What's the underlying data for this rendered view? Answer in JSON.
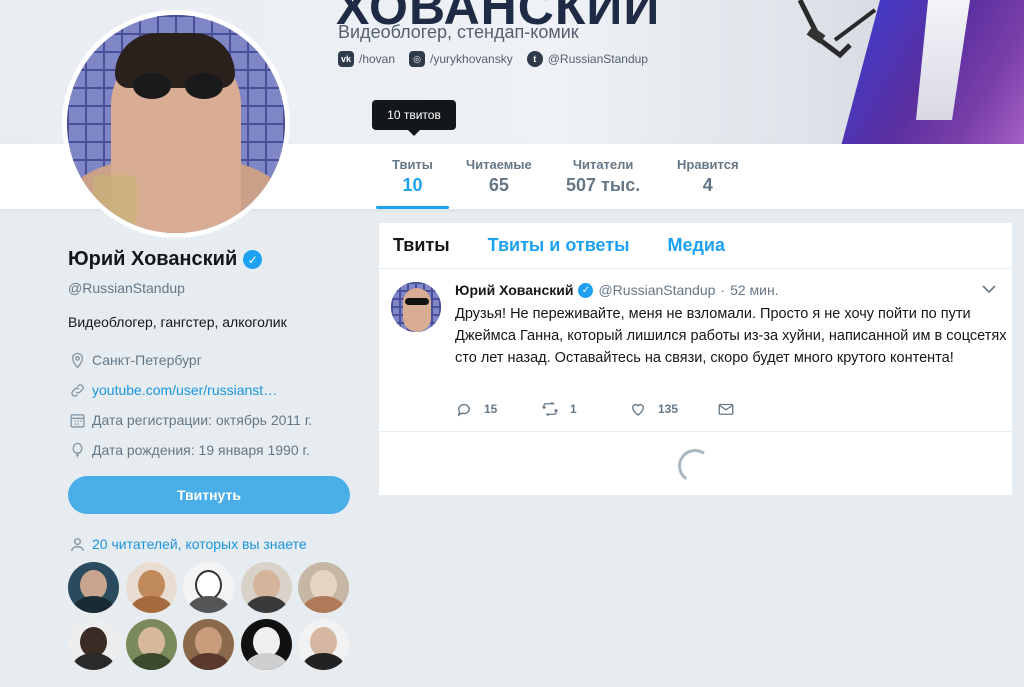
{
  "banner": {
    "title": "ХОВАНСКИЙ",
    "subtitle": "Видеоблогер, стендап-комик",
    "social": [
      {
        "icon": "vk-icon",
        "badge": "vk",
        "text": "/hovan"
      },
      {
        "icon": "instagram-icon",
        "badge": "◎",
        "text": "/yurykhovansky"
      },
      {
        "icon": "twitter-icon",
        "badge": "t",
        "text": "@RussianStandup"
      }
    ]
  },
  "tooltip": "10 твитов",
  "stats": [
    {
      "label": "Твиты",
      "value": "10"
    },
    {
      "label": "Читаемые",
      "value": "65"
    },
    {
      "label": "Читатели",
      "value": "507 тыс."
    },
    {
      "label": "Нравится",
      "value": "4"
    }
  ],
  "profile": {
    "name": "Юрий Хованский",
    "verified_mark": "✓",
    "handle": "@RussianStandup",
    "bio": "Видеоблогер, гангстер, алкоголик",
    "location": "Санкт-Петербург",
    "link": "youtube.com/user/russianst…",
    "joined": "Дата регистрации: октябрь 2011 г.",
    "birthday": "Дата рождения: 19 января 1990 г."
  },
  "tweet_button": "Твитнуть",
  "followers_you_know": "20 читателей, которых вы знаете",
  "timeline": {
    "tabs": [
      "Твиты",
      "Твиты и ответы",
      "Медиа"
    ],
    "tweet": {
      "name": "Юрий Хованский",
      "handle": "@RussianStandup",
      "dot": "·",
      "time": "52 мин.",
      "text": "Друзья! Не переживайте, меня не взломали. Просто я не хочу пойти по пути Джеймса Ганна, который лишился работы из-за хуйни, написанной им в соцсетях сто лет назад. Оставайтесь на связи, скоро будет много крутого контента!",
      "replies": "15",
      "retweets": "1",
      "likes": "135"
    }
  },
  "colors": {
    "accent": "#1da1f2",
    "tweet_button": "#4aaee8",
    "background": "#e6ecf0"
  }
}
